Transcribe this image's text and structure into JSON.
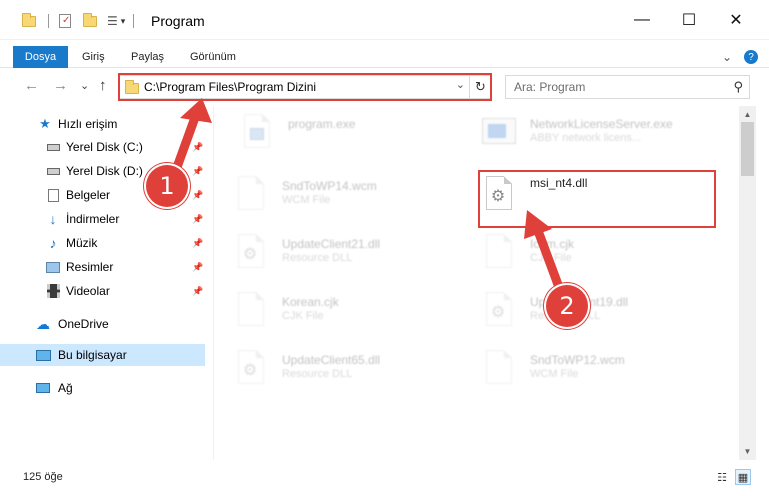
{
  "window": {
    "title": "Program",
    "minimize_glyph": "—",
    "maximize_glyph": "☐",
    "close_glyph": "✕"
  },
  "ribbon": {
    "file_tab": "Dosya",
    "tabs": [
      "Giriş",
      "Paylaş",
      "Görünüm"
    ],
    "expand_glyph": "⌄",
    "help_glyph": "?"
  },
  "nav": {
    "back_glyph": "←",
    "forward_glyph": "→",
    "recent_glyph": "⌄",
    "up_glyph": "↑",
    "address": "C:\\Program Files\\Program Dizini",
    "dropdown_glyph": "⌄",
    "refresh_glyph": "↻",
    "search_placeholder": "Ara: Program",
    "search_glyph": "⚲"
  },
  "sidebar": {
    "items": [
      {
        "label": "Hızlı erişim",
        "icon": "star-icon",
        "pinned": false
      },
      {
        "label": "Yerel Disk (C:)",
        "icon": "drive-icon",
        "pinned": true
      },
      {
        "label": "Yerel Disk (D:)",
        "icon": "drive-icon",
        "pinned": true
      },
      {
        "label": "Belgeler",
        "icon": "documents-icon",
        "pinned": true
      },
      {
        "label": "İndirmeler",
        "icon": "downloads-icon",
        "pinned": true
      },
      {
        "label": "Müzik",
        "icon": "music-icon",
        "pinned": true
      },
      {
        "label": "Resimler",
        "icon": "pictures-icon",
        "pinned": true
      },
      {
        "label": "Videolar",
        "icon": "videos-icon",
        "pinned": true
      },
      {
        "label": "OneDrive",
        "icon": "cloud-icon",
        "pinned": false
      },
      {
        "label": "Bu bilgisayar",
        "icon": "computer-icon",
        "pinned": false,
        "selected": true
      },
      {
        "label": "Ağ",
        "icon": "network-icon",
        "pinned": false
      }
    ],
    "pin_glyph": "📌"
  },
  "files": [
    {
      "name": "program.exe",
      "type": "",
      "faded": true,
      "icon": "exe-icon"
    },
    {
      "name": "NetworkLicenseServer.exe",
      "type": "ABBY network licens...",
      "faded": true,
      "icon": "exe-icon"
    },
    {
      "name": "SndToWP14.wcm",
      "type": "WCM File",
      "faded": true,
      "icon": "file-icon"
    },
    {
      "name": "msi_nt4.dll",
      "type": "",
      "faded": false,
      "icon": "dll-icon"
    },
    {
      "name": "UpdateClient21.dll",
      "type": "Resource DLL",
      "faded": true,
      "icon": "dll-icon"
    },
    {
      "name": "Icom.cjk",
      "type": "CJK File",
      "faded": true,
      "icon": "file-icon"
    },
    {
      "name": "Korean.cjk",
      "type": "CJK File",
      "faded": true,
      "icon": "file-icon"
    },
    {
      "name": "UpdateClient19.dll",
      "type": "Resource DLL",
      "faded": true,
      "icon": "dll-icon"
    },
    {
      "name": "UpdateClient65.dll",
      "type": "Resource DLL",
      "faded": true,
      "icon": "dll-icon"
    },
    {
      "name": "SndToWP12.wcm",
      "type": "WCM File",
      "faded": true,
      "icon": "file-icon"
    }
  ],
  "status": {
    "item_count": "125 öğe"
  },
  "callouts": {
    "step1": "1",
    "step2": "2"
  },
  "colors": {
    "accent": "#1979ca",
    "highlight": "#e0403a",
    "selection": "#cce8ff"
  }
}
